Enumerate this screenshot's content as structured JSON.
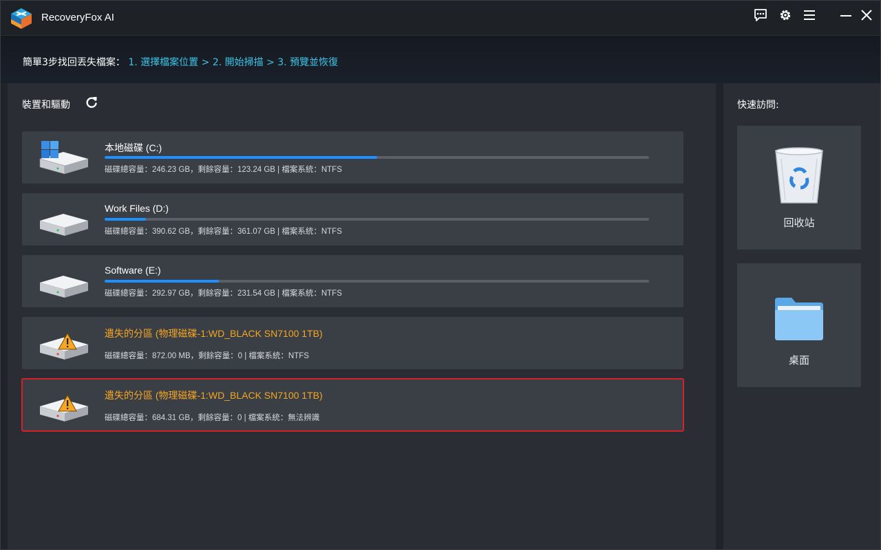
{
  "app": {
    "title": "RecoveryFox AI"
  },
  "titlebar": {
    "buttons": [
      {
        "name": "feedback",
        "icon": "chat-icon"
      },
      {
        "name": "settings",
        "icon": "gear-icon"
      },
      {
        "name": "menu",
        "icon": "hamburger-menu-icon"
      },
      {
        "name": "minimize",
        "icon": "minimize-icon"
      },
      {
        "name": "close",
        "icon": "close-icon"
      }
    ]
  },
  "steps": {
    "prefix": "簡單3步找回丟失檔案：",
    "link": "1. 選擇檔案位置 > 2. 開始掃描 > 3. 預覽並恢復"
  },
  "devices": {
    "title": "裝置和驅動",
    "refresh_icon": "refresh-icon",
    "drives": [
      {
        "name": "本地磁碟 (C:)",
        "info": "磁碟總容量：246.23 GB，剩餘容量：123.24 GB | 檔案系統：NTFS",
        "usage": 0.5,
        "icon": "windows-drive-icon",
        "lost": false
      },
      {
        "name": "Work Files (D:)",
        "info": "磁碟總容量：390.62 GB，剩餘容量：361.07 GB | 檔案系統：NTFS",
        "usage": 0.076,
        "icon": "hard-drive-icon",
        "lost": false
      },
      {
        "name": "Software (E:)",
        "info": "磁碟總容量：292.97 GB，剩餘容量：231.54 GB | 檔案系統：NTFS",
        "usage": 0.21,
        "icon": "hard-drive-icon",
        "lost": false
      },
      {
        "name": "遺失的分區 (物理磁碟-1:WD_BLACK SN7100 1TB)",
        "info": "磁碟總容量：872.00 MB，剩餘容量：0 | 檔案系統：NTFS",
        "icon": "lost-partition-warning-icon",
        "lost": true
      },
      {
        "name": "遺失的分區 (物理磁碟-1:WD_BLACK SN7100 1TB)",
        "info": "磁碟總容量：684.31 GB，剩餘容量：0 | 檔案系統：無法辨識",
        "icon": "lost-partition-warning-icon",
        "lost": true,
        "selected": true
      }
    ]
  },
  "quick_access": {
    "title": "快速訪問:",
    "items": [
      {
        "label": "回收站",
        "icon": "recycle-bin-icon"
      },
      {
        "label": "桌面",
        "icon": "folder-icon"
      }
    ]
  },
  "colors": {
    "accent": "#3cc4e6",
    "progress": "#1e90ff",
    "warning_text": "#f5a623",
    "selection_border": "#d8202b"
  }
}
